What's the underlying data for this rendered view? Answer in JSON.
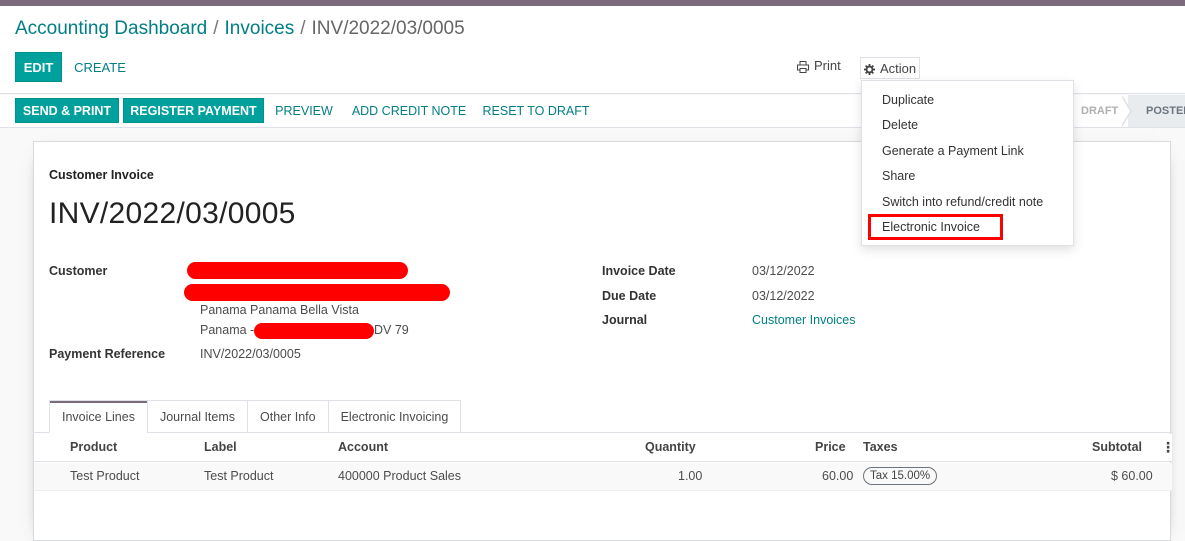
{
  "breadcrumb": {
    "root": "Accounting Dashboard",
    "parent": "Invoices",
    "current": "INV/2022/03/0005",
    "separator": "/"
  },
  "control_panel": {
    "edit_label": "EDIT",
    "create_label": "CREATE",
    "print_label": "Print",
    "action_label": "Action",
    "print_icon": "printer-icon",
    "action_icon": "gear-icon"
  },
  "action_menu": {
    "items": [
      "Duplicate",
      "Delete",
      "Generate a Payment Link",
      "Share",
      "Switch into refund/credit note",
      "Electronic Invoice"
    ],
    "highlighted": "Electronic Invoice",
    "highlight_color": "#ff0000"
  },
  "statusbar": {
    "send_print": "SEND & PRINT",
    "register_payment": "REGISTER PAYMENT",
    "preview": "PREVIEW",
    "add_credit_note": "ADD CREDIT NOTE",
    "reset_to_draft": "RESET TO DRAFT",
    "stages": [
      "DRAFT",
      "POSTED"
    ],
    "current_stage": "POSTED"
  },
  "invoice": {
    "type": "Customer Invoice",
    "name": "INV/2022/03/0005",
    "customer_label": "Customer",
    "address_line_1": "Panama Panama Bella Vista",
    "address_line_2_prefix": "Panama -",
    "address_line_2_suffix": "DV 79",
    "payment_reference_label": "Payment Reference",
    "payment_reference": "INV/2022/03/0005",
    "invoice_date_label": "Invoice Date",
    "invoice_date": "03/12/2022",
    "due_date_label": "Due Date",
    "due_date": "03/12/2022",
    "journal_label": "Journal",
    "journal": "Customer Invoices"
  },
  "tabs": [
    "Invoice Lines",
    "Journal Items",
    "Other Info",
    "Electronic Invoicing"
  ],
  "active_tab": "Invoice Lines",
  "lines_table": {
    "headers": {
      "product": "Product",
      "label": "Label",
      "account": "Account",
      "quantity": "Quantity",
      "price": "Price",
      "taxes": "Taxes",
      "subtotal": "Subtotal"
    },
    "rows": [
      {
        "product": "Test Product",
        "label": "Test Product",
        "account": "400000 Product Sales",
        "quantity": "1.00",
        "price": "60.00",
        "taxes": "Tax 15.00%",
        "subtotal": "$ 60.00"
      }
    ]
  },
  "colors": {
    "primary": "#00a09d",
    "link": "#017e84",
    "brand_band": "#7c6b7c",
    "redaction": "#ff0000"
  }
}
